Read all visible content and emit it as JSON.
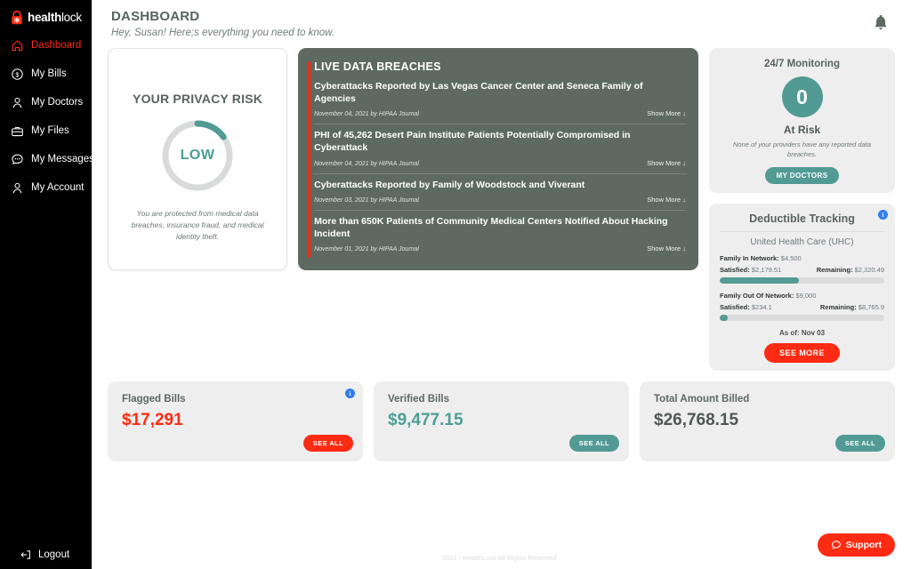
{
  "brand": {
    "name_bold": "health",
    "name_light": "lock",
    "logo_icon": "padlock-medical-icon",
    "accent_red": "#fd2b13",
    "accent_teal": "#529b94",
    "panel_grey": "#5e6a61"
  },
  "sidebar": {
    "items": [
      {
        "label": "Dashboard",
        "icon": "home-icon",
        "active": true
      },
      {
        "label": "My Bills",
        "icon": "dollar-circle-icon",
        "active": false
      },
      {
        "label": "My Doctors",
        "icon": "person-icon",
        "active": false
      },
      {
        "label": "My Files",
        "icon": "briefcase-icon",
        "active": false
      },
      {
        "label": "My Messages",
        "icon": "chat-bubble-icon",
        "active": false
      },
      {
        "label": "My Account",
        "icon": "person-icon",
        "active": false
      }
    ],
    "logout": {
      "label": "Logout",
      "icon": "logout-icon"
    }
  },
  "header": {
    "title": "DASHBOARD",
    "subtitle": "Hey, Susan! Here;s everything you need to know.",
    "bell_icon": "notification-bell-icon"
  },
  "privacy_risk": {
    "title": "YOUR PRIVACY RISK",
    "level": "LOW",
    "gauge_percent": 15,
    "note": "You are protected from medical data breaches, insurance fraud, and medical identity theft."
  },
  "breaches": {
    "title": "LIVE DATA BREACHES",
    "show_more_label": "Show More",
    "items": [
      {
        "title": "Cyberattacks Reported by Las Vegas Cancer Center and Seneca Family of Agencies",
        "date": "November 04, 2021 by HIPAA Journal"
      },
      {
        "title": "PHI of 45,262 Desert Pain Institute Patients Potentially Compromised in Cyberattack",
        "date": "November 04, 2021 by HIPAA Journal"
      },
      {
        "title": "Cyberattacks Reported by Family of Woodstock and Viverant",
        "date": "November 03, 2021 by HIPAA Journal"
      },
      {
        "title": "More than 650K Patients of Community Medical Centers Notified About Hacking Incident",
        "date": "November 01, 2021 by HIPAA Journal"
      }
    ]
  },
  "monitoring": {
    "title": "24/7 Monitoring",
    "count": "0",
    "status": "At Risk",
    "note": "None of your providers have any reported data breaches.",
    "button_label": "MY DOCTORS"
  },
  "deductible": {
    "title": "Deductible Tracking",
    "plan": "United Health Care (UHC)",
    "info_badge": "i",
    "rows": [
      {
        "name": "Family In Network:",
        "total": "$4,500",
        "satisfied_label": "Satisfied:",
        "satisfied_value": "$2,179.51",
        "remaining_label": "Remaining:",
        "remaining_value": "$2,320.49",
        "percent": 48
      },
      {
        "name": "Family Out Of Network:",
        "total": "$9,000",
        "satisfied_label": "Satisfied:",
        "satisfied_value": "$234.1",
        "remaining_label": "Remaining:",
        "remaining_value": "$8,765.9",
        "percent": 5
      }
    ],
    "as_of": "As of: Nov 03",
    "button_label": "SEE MORE"
  },
  "stats": [
    {
      "label": "Flagged Bills",
      "value": "$17,291",
      "value_color": "red",
      "button_label": "SEE ALL",
      "button_color": "red",
      "info_badge": "i"
    },
    {
      "label": "Verified Bills",
      "value": "$9,477.15",
      "value_color": "teal",
      "button_label": "SEE ALL",
      "button_color": "teal",
      "info_badge": ""
    },
    {
      "label": "Total Amount Billed",
      "value": "$26,768.15",
      "value_color": "grey",
      "button_label": "SEE ALL",
      "button_color": "teal",
      "info_badge": ""
    }
  ],
  "footer": {
    "text": "2021 - HealthLock All Rights Reserved -"
  },
  "support": {
    "label": "Support",
    "icon": "chat-bubble-icon"
  }
}
